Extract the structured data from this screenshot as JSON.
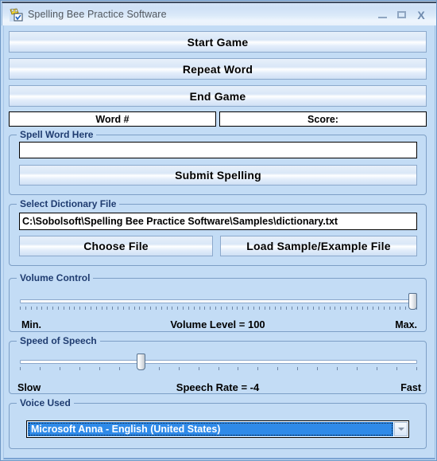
{
  "window": {
    "title": "Spelling Bee Practice Software",
    "icon": "app-bee-icon",
    "controls": {
      "minimize": "minimize-icon",
      "maximize": "maximize-icon",
      "close": "X"
    }
  },
  "actions": {
    "start_game": "Start Game",
    "repeat_word": "Repeat Word",
    "end_game": "End Game"
  },
  "status": {
    "word_number": "Word #",
    "score": "Score:"
  },
  "spell_word": {
    "group_label": "Spell Word Here",
    "input_value": "",
    "input_placeholder": "",
    "submit_label": "Submit Spelling"
  },
  "dictionary": {
    "group_label": "Select Dictionary File",
    "path_value": "C:\\Sobolsoft\\Spelling Bee Practice Software\\Samples\\dictionary.txt",
    "choose_file_label": "Choose File",
    "load_sample_label": "Load Sample/Example File"
  },
  "volume": {
    "group_label": "Volume Control",
    "min_label": "Min.",
    "max_label": "Max.",
    "value_label": "Volume Level = 100",
    "value": 100,
    "min": 0,
    "max": 100,
    "tick_count": 74
  },
  "speech_speed": {
    "group_label": "Speed of Speech",
    "min_label": "Slow",
    "max_label": "Fast",
    "value_label": "Speech Rate = -4",
    "value": -4,
    "min": -10,
    "max": 10,
    "tick_count": 21
  },
  "voice": {
    "group_label": "Voice Used",
    "selected": "Microsoft Anna - English (United States)",
    "arrow_icon": "chevron-down-icon"
  },
  "colors": {
    "background": "#c3dcf5",
    "group_border": "#7d9fc6",
    "label_text": "#1f3c70",
    "selection": "#2f8ae8"
  }
}
